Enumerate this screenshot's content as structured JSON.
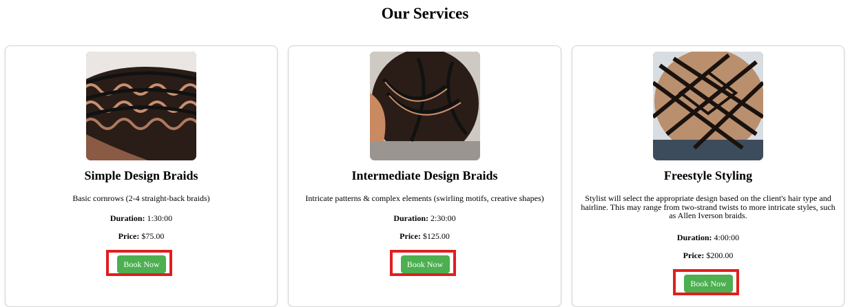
{
  "page": {
    "title": "Our Services"
  },
  "labels": {
    "duration": "Duration:",
    "price": "Price:"
  },
  "colors": {
    "accent": "#4caf50",
    "highlight": "#e01e1e"
  },
  "services": [
    {
      "name": "Simple Design Braids",
      "description": "Basic cornrows (2-4 straight-back braids)",
      "duration": "1:30:00",
      "price": "$75.00",
      "button_label": "Book Now"
    },
    {
      "name": "Intermediate Design Braids",
      "description": "Intricate patterns & complex elements (swirling motifs, creative shapes)",
      "duration": "2:30:00",
      "price": "$125.00",
      "button_label": "Book Now"
    },
    {
      "name": "Freestyle Styling",
      "description": "Stylist will select the appropriate design based on the client's hair type and hairline. This may range from two-strand twists to more intricate styles, such as Allen Iverson braids.",
      "duration": "4:00:00",
      "price": "$200.00",
      "button_label": "Book Now"
    }
  ]
}
